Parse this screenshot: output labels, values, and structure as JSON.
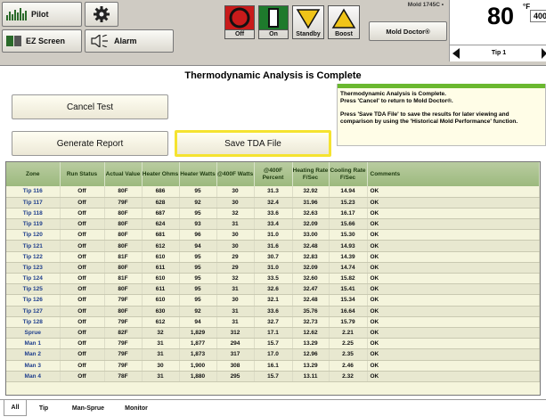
{
  "toolbar": {
    "pilot_label": "Pilot",
    "ez_screen_label": "EZ Screen",
    "alarm_label": "Alarm",
    "off_label": "Off",
    "on_label": "On",
    "standby_label": "Standby",
    "boost_label": "Boost",
    "mold_name": "Mold 1745C •",
    "mold_doctor_label": "Mold Doctor®",
    "temp_value": "80",
    "temp_unit": "°F",
    "setpoint": "400",
    "zone_label": "Tip 1",
    "colors": {
      "off": "#d11f1f",
      "on": "#1e7a2c",
      "standby": "#f0c419",
      "boost": "#f0c419",
      "highlight": "#f5e330",
      "msg_bar": "#6ab82f"
    }
  },
  "title": "Thermodynamic Analysis is Complete",
  "buttons": {
    "cancel": "Cancel Test",
    "report": "Generate Report",
    "save": "Save TDA File"
  },
  "message": {
    "line1": "Thermodynamic Analysis is Complete.",
    "line2": "Press 'Cancel' to return to Mold Doctor®.",
    "line3": "Press 'Save TDA File' to save the results for later viewing and comparison by using the 'Historical Mold Performance' function."
  },
  "table": {
    "headers": [
      "Zone",
      "Run Status",
      "Actual Value",
      "Heater Ohms",
      "Heater Watts",
      "@400F Watts",
      "@400F Percent",
      "Heating Rate F/Sec",
      "Cooling Rate F/Sec",
      "Comments"
    ],
    "rows": [
      [
        "Tip 116",
        "Off",
        "80F",
        "686",
        "95",
        "30",
        "31.3",
        "32.92",
        "14.94",
        "OK"
      ],
      [
        "Tip 117",
        "Off",
        "79F",
        "628",
        "92",
        "30",
        "32.4",
        "31.96",
        "15.23",
        "OK"
      ],
      [
        "Tip 118",
        "Off",
        "80F",
        "687",
        "95",
        "32",
        "33.6",
        "32.63",
        "16.17",
        "OK"
      ],
      [
        "Tip 119",
        "Off",
        "80F",
        "624",
        "93",
        "31",
        "33.4",
        "32.09",
        "15.66",
        "OK"
      ],
      [
        "Tip 120",
        "Off",
        "80F",
        "681",
        "96",
        "30",
        "31.0",
        "33.00",
        "15.30",
        "OK"
      ],
      [
        "Tip 121",
        "Off",
        "80F",
        "612",
        "94",
        "30",
        "31.6",
        "32.48",
        "14.93",
        "OK"
      ],
      [
        "Tip 122",
        "Off",
        "81F",
        "610",
        "95",
        "29",
        "30.7",
        "32.83",
        "14.39",
        "OK"
      ],
      [
        "Tip 123",
        "Off",
        "80F",
        "611",
        "95",
        "29",
        "31.0",
        "32.09",
        "14.74",
        "OK"
      ],
      [
        "Tip 124",
        "Off",
        "81F",
        "610",
        "95",
        "32",
        "33.5",
        "32.60",
        "15.82",
        "OK"
      ],
      [
        "Tip 125",
        "Off",
        "80F",
        "611",
        "95",
        "31",
        "32.6",
        "32.47",
        "15.41",
        "OK"
      ],
      [
        "Tip 126",
        "Off",
        "79F",
        "610",
        "95",
        "30",
        "32.1",
        "32.48",
        "15.34",
        "OK"
      ],
      [
        "Tip 127",
        "Off",
        "80F",
        "630",
        "92",
        "31",
        "33.6",
        "35.76",
        "16.64",
        "OK"
      ],
      [
        "Tip 128",
        "Off",
        "79F",
        "612",
        "94",
        "31",
        "32.7",
        "32.73",
        "15.79",
        "OK"
      ],
      [
        "Sprue",
        "Off",
        "82F",
        "32",
        "1,829",
        "312",
        "17.1",
        "12.62",
        "2.21",
        "OK"
      ],
      [
        "Man 1",
        "Off",
        "79F",
        "31",
        "1,877",
        "294",
        "15.7",
        "13.29",
        "2.25",
        "OK"
      ],
      [
        "Man 2",
        "Off",
        "79F",
        "31",
        "1,873",
        "317",
        "17.0",
        "12.96",
        "2.35",
        "OK"
      ],
      [
        "Man 3",
        "Off",
        "79F",
        "30",
        "1,900",
        "308",
        "16.1",
        "13.29",
        "2.46",
        "OK"
      ],
      [
        "Man 4",
        "Off",
        "78F",
        "31",
        "1,880",
        "295",
        "15.7",
        "13.11",
        "2.32",
        "OK"
      ]
    ]
  },
  "tabs": [
    "All",
    "Tip",
    "Man-Sprue",
    "Monitor"
  ]
}
